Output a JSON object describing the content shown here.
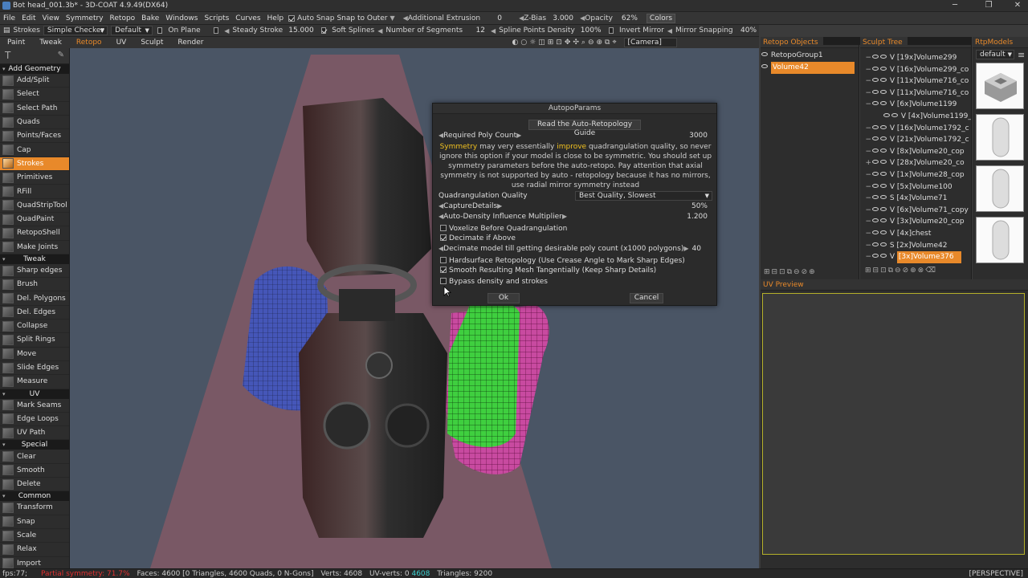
{
  "window": {
    "title": "Bot head_001.3b* - 3D-COAT 4.9.49(DX64)"
  },
  "menubar": {
    "items": [
      "File",
      "Edit",
      "View",
      "Symmetry",
      "Retopo",
      "Bake",
      "Windows",
      "Scripts",
      "Curves",
      "Help"
    ],
    "auto_snap": "Auto Snap",
    "snap_to": "Snap to Outer",
    "additional_extrusion": "Additional Extrusion",
    "additional_extrusion_val": "0",
    "z_bias": "Z-Bias",
    "z_bias_val": "3.000",
    "opacity": "Opacity",
    "opacity_val": "62%",
    "colors": "Colors"
  },
  "toolbar": {
    "strokes": "Strokes",
    "checker": "Simple Checker",
    "preset": "Default",
    "on_plane": "On Plane",
    "steady_stroke": "Steady Stroke",
    "steady_stroke_val": "15.000",
    "soft_splines": "Soft Splines",
    "num_segments": "Number of Segments",
    "num_segments_val": "12",
    "spline_density": "Spline Points Density",
    "spline_density_val": "100%",
    "invert_mirror": "Invert Mirror",
    "mirror_snapping": "Mirror Snapping",
    "mirror_snapping_val": "40%",
    "camera": "[Camera]"
  },
  "rooms": [
    "Paint",
    "Tweak",
    "Retopo",
    "UV",
    "Sculpt",
    "Render"
  ],
  "leftpanel": {
    "header": "Add Geometry",
    "items": [
      "Add/Split",
      "Select",
      "Select Path",
      "Quads",
      "Points/Faces",
      "Cap",
      "Strokes",
      "Primitives",
      "RFill",
      "QuadStripTool",
      "QuadPaint",
      "RetopoShell",
      "Make Joints"
    ],
    "tweak_header": "Tweak",
    "tweak_items": [
      "Sharp edges",
      "Brush",
      "Del. Polygons",
      "Del. Edges",
      "Collapse",
      "Split Rings",
      "Move",
      "Slide Edges",
      "Measure"
    ],
    "uv_header": "UV",
    "uv_items": [
      "Mark Seams",
      "Edge Loops",
      "UV Path"
    ],
    "special_header": "Special",
    "special_items": [
      "Clear",
      "Smooth",
      "Delete"
    ],
    "common_header": "Common",
    "common_items": [
      "Transform",
      "Snap",
      "Scale",
      "Relax",
      "Import"
    ]
  },
  "dialog": {
    "title": "AutopoParams",
    "guide_button": "Read the Auto-Retopology Guide",
    "required_poly": "Required Poly Count",
    "required_poly_val": "3000",
    "note_symmetry": "Symmetry",
    "note_part1": " may very essentially ",
    "note_improve": "improve",
    "note_part2": " quadrangulation quality, so never ignore this option if your model is close to be symmetric. You should set up symmetry parameters before the auto-retopo. Pay attention that axial symmetry is not supported by auto - retopology because it has no mirrors, use radial mirror symmetry instead",
    "quad_quality": "Quadrangulation Quality",
    "quad_quality_val": "Best Quality, Slowest",
    "capture_details": "CaptureDetails",
    "capture_details_val": "50%",
    "auto_density": "Auto-Density Influence Multiplier",
    "auto_density_val": "1.200",
    "voxelize": "Voxelize Before Quadrangulation",
    "decimate": "Decimate if Above",
    "decimate_model": "Decimate model till getting desirable poly count (x1000 polygons)",
    "decimate_model_val": "40",
    "hardsurface": "Hardsurface Retopology (Use Crease Angle to Mark Sharp Edges)",
    "smooth_mesh": "Smooth Resulting Mesh Tangentially (Keep Sharp Details)",
    "bypass": "Bypass density and strokes",
    "ok": "Ok",
    "cancel": "Cancel"
  },
  "retopo_objects": {
    "header": "Retopo Objects",
    "items": [
      "RetopoGroup1",
      "Volume42"
    ]
  },
  "sculpt_tree": {
    "header": "Sculpt Tree",
    "items": [
      "[19x]Volume299",
      "[16x]Volume299_co",
      "[11x]Volume716_co",
      "[11x]Volume716_co",
      "[6x]Volume1199",
      "[4x]Volume1199_",
      "[16x]Volume1792_c",
      "[21x]Volume1792_c",
      "[8x]Volume20_cop",
      "[28x]Volume20_co",
      "[1x]Volume28_cop",
      "[5x]Volume100",
      "[4x]Volume71",
      "[6x]Volume71_copy",
      "[3x]Volume20_cop",
      "[4x]chest",
      "[2x]Volume42",
      "[3x]Volume376"
    ]
  },
  "rtp_models": {
    "header": "RtpModels",
    "preset": "default"
  },
  "uv_preview": {
    "header": "UV Preview"
  },
  "status": {
    "fps": "fps:77;",
    "partial_symmetry": "Partial symmetry: 71.7%",
    "faces": "Faces: 4600 [0 Triangles, 4600 Quads, 0 N-Gons]",
    "verts": "Verts: 4608",
    "uv_verts": "UV-verts: 0",
    "uv_verts_hl": "4608",
    "triangles": "Triangles: 9200",
    "perspective": "[PERSPECTIVE]"
  },
  "colors": {
    "accent": "#e8892a",
    "highlight": "#f0c020"
  }
}
